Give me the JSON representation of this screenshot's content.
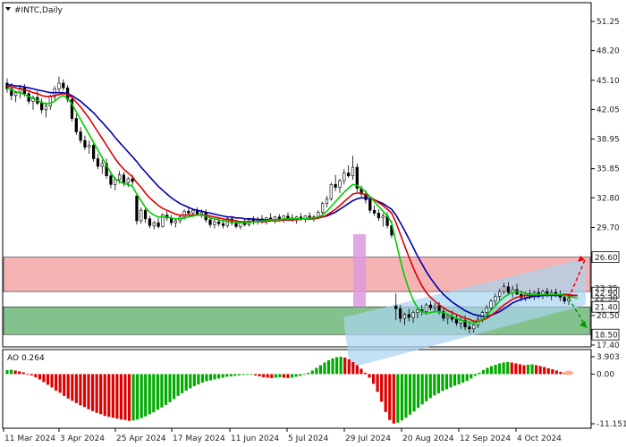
{
  "chart_data": {
    "type": "candlestick",
    "title": "#INTC,Daily",
    "ao_label": "AO 0.264",
    "price_ticks": [
      "51.25",
      "48.20",
      "45.10",
      "42.05",
      "38.95",
      "35.85",
      "32.80",
      "29.70",
      "20.50",
      "17.40"
    ],
    "level_labels": [
      "26.60",
      "22.90",
      "21.40",
      "18.50"
    ],
    "extra_labels": [
      "23.35",
      "22.30"
    ],
    "ao_ticks": [
      "3.903",
      "0.00",
      "-11.151"
    ],
    "x_labels": [
      "11 Mar 2024",
      "3 Apr 2024",
      "25 Apr 2024",
      "17 May 2024",
      "11 Jun 2024",
      "5 Jul 2024",
      "29 Jul 2024",
      "20 Aug 2024",
      "12 Sep 2024",
      "4 Oct 2024"
    ],
    "resistance_zone": [
      23.0,
      26.6
    ],
    "support_zone": [
      18.5,
      21.4
    ],
    "colors": {
      "bull": "#000000",
      "bear": "#000000",
      "ma_fast": "#00cc00",
      "ma_mid": "#dd0000",
      "ma_slow": "#0000aa",
      "resistance": "#f4a6a6",
      "support": "#6fb87a",
      "channel": "#a9d4f0",
      "ao_up": "#00aa00",
      "ao_down": "#dd0000",
      "arrow_up": "#ff0000",
      "arrow_down": "#009900"
    },
    "candles": [
      [
        44.8,
        45.3,
        43.8,
        44.2
      ],
      [
        44.2,
        44.8,
        43.0,
        43.5
      ],
      [
        43.5,
        44.0,
        42.8,
        43.8
      ],
      [
        43.8,
        44.6,
        43.2,
        44.3
      ],
      [
        44.3,
        44.7,
        43.4,
        43.7
      ],
      [
        43.7,
        44.1,
        42.6,
        42.9
      ],
      [
        42.9,
        43.5,
        42.0,
        43.3
      ],
      [
        43.3,
        44.0,
        42.5,
        42.7
      ],
      [
        42.7,
        43.2,
        41.6,
        42.0
      ],
      [
        42.0,
        42.8,
        41.2,
        42.4
      ],
      [
        42.4,
        43.6,
        42.0,
        43.4
      ],
      [
        43.4,
        44.5,
        43.0,
        44.2
      ],
      [
        44.2,
        45.5,
        43.9,
        44.8
      ],
      [
        44.8,
        45.2,
        44.0,
        44.3
      ],
      [
        44.3,
        44.6,
        42.8,
        43.1
      ],
      [
        43.1,
        43.4,
        40.8,
        41.1
      ],
      [
        41.1,
        41.6,
        39.4,
        39.7
      ],
      [
        39.7,
        40.2,
        38.5,
        38.8
      ],
      [
        38.8,
        39.3,
        37.8,
        38.1
      ],
      [
        38.1,
        38.8,
        37.4,
        38.3
      ],
      [
        38.3,
        38.6,
        36.6,
        36.9
      ],
      [
        36.9,
        37.4,
        35.8,
        36.1
      ],
      [
        36.1,
        36.8,
        35.3,
        36.4
      ],
      [
        36.4,
        36.9,
        34.8,
        35.1
      ],
      [
        35.1,
        35.6,
        33.8,
        34.2
      ],
      [
        34.2,
        35.0,
        33.6,
        34.7
      ],
      [
        34.7,
        35.6,
        34.3,
        35.2
      ],
      [
        35.2,
        35.5,
        34.0,
        34.4
      ],
      [
        34.4,
        35.0,
        33.9,
        34.8
      ],
      [
        34.8,
        35.2,
        34.1,
        34.5
      ],
      [
        33.0,
        33.3,
        30.0,
        30.4
      ],
      [
        30.4,
        31.8,
        30.1,
        31.5
      ],
      [
        31.5,
        31.8,
        30.2,
        30.6
      ],
      [
        30.6,
        30.9,
        29.6,
        29.9
      ],
      [
        29.9,
        30.4,
        29.5,
        30.2
      ],
      [
        30.2,
        30.7,
        29.6,
        29.8
      ],
      [
        29.8,
        31.2,
        29.7,
        31.0
      ],
      [
        31.0,
        31.5,
        30.4,
        30.7
      ],
      [
        30.7,
        31.0,
        29.9,
        30.2
      ],
      [
        30.2,
        30.6,
        29.7,
        30.4
      ],
      [
        30.4,
        31.0,
        30.1,
        30.8
      ],
      [
        30.8,
        31.6,
        30.5,
        31.4
      ],
      [
        31.4,
        31.9,
        30.9,
        31.2
      ],
      [
        31.2,
        31.7,
        30.8,
        31.5
      ],
      [
        31.5,
        31.8,
        30.9,
        31.1
      ],
      [
        31.1,
        31.6,
        30.7,
        31.3
      ],
      [
        31.3,
        31.6,
        30.2,
        30.5
      ],
      [
        30.5,
        30.9,
        29.7,
        30.0
      ],
      [
        30.0,
        30.6,
        29.6,
        30.3
      ],
      [
        30.3,
        30.7,
        29.8,
        30.1
      ],
      [
        30.1,
        30.5,
        29.6,
        29.9
      ],
      [
        29.9,
        30.8,
        29.7,
        30.6
      ],
      [
        30.6,
        30.9,
        29.9,
        30.2
      ],
      [
        30.2,
        30.5,
        29.6,
        29.8
      ],
      [
        29.8,
        30.4,
        29.5,
        30.2
      ],
      [
        30.2,
        30.6,
        29.8,
        30.0
      ],
      [
        30.0,
        30.7,
        29.8,
        30.5
      ],
      [
        30.5,
        30.9,
        30.0,
        30.3
      ],
      [
        30.3,
        30.8,
        30.0,
        30.6
      ],
      [
        30.6,
        31.0,
        30.1,
        30.4
      ],
      [
        30.4,
        30.8,
        30.0,
        30.7
      ],
      [
        30.7,
        31.2,
        30.3,
        30.5
      ],
      [
        30.5,
        30.9,
        30.1,
        30.8
      ],
      [
        30.8,
        31.1,
        30.3,
        30.6
      ],
      [
        30.6,
        31.0,
        30.2,
        30.9
      ],
      [
        30.9,
        31.3,
        30.4,
        30.7
      ],
      [
        30.7,
        31.1,
        30.3,
        30.5
      ],
      [
        30.5,
        30.9,
        30.1,
        30.8
      ],
      [
        30.8,
        31.2,
        30.4,
        30.6
      ],
      [
        30.6,
        31.0,
        30.2,
        30.9
      ],
      [
        30.9,
        31.3,
        30.5,
        30.7
      ],
      [
        30.7,
        31.0,
        30.3,
        30.8
      ],
      [
        30.8,
        31.5,
        30.6,
        31.3
      ],
      [
        31.3,
        32.4,
        31.1,
        32.2
      ],
      [
        32.2,
        33.0,
        31.8,
        32.7
      ],
      [
        32.7,
        34.4,
        32.5,
        34.2
      ],
      [
        34.2,
        35.2,
        33.5,
        33.9
      ],
      [
        33.9,
        34.8,
        33.3,
        34.6
      ],
      [
        34.6,
        35.8,
        34.2,
        35.4
      ],
      [
        35.4,
        36.2,
        34.9,
        35.1
      ],
      [
        35.1,
        37.2,
        34.7,
        36.0
      ],
      [
        36.0,
        36.4,
        33.4,
        33.8
      ],
      [
        33.8,
        34.1,
        32.9,
        33.2
      ],
      [
        33.2,
        33.6,
        32.2,
        32.6
      ],
      [
        32.6,
        33.0,
        31.2,
        31.5
      ],
      [
        31.5,
        32.0,
        30.9,
        31.2
      ],
      [
        31.2,
        31.6,
        30.4,
        30.7
      ],
      [
        30.7,
        31.2,
        29.8,
        30.9
      ],
      [
        30.9,
        31.3,
        29.6,
        29.9
      ],
      [
        29.9,
        30.4,
        28.6,
        28.9
      ],
      [
        21.5,
        22.8,
        20.0,
        21.2
      ],
      [
        21.2,
        21.6,
        19.8,
        20.2
      ],
      [
        20.2,
        20.8,
        19.5,
        20.6
      ],
      [
        20.6,
        21.2,
        19.9,
        20.3
      ],
      [
        20.3,
        21.0,
        19.7,
        20.8
      ],
      [
        20.8,
        21.4,
        20.2,
        21.1
      ],
      [
        21.1,
        21.6,
        20.5,
        20.9
      ],
      [
        20.9,
        21.8,
        20.6,
        21.6
      ],
      [
        21.6,
        22.0,
        21.0,
        21.3
      ],
      [
        21.3,
        21.8,
        20.8,
        21.5
      ],
      [
        21.5,
        21.9,
        20.6,
        20.9
      ],
      [
        20.9,
        21.3,
        19.9,
        20.2
      ],
      [
        20.2,
        20.7,
        19.6,
        20.4
      ],
      [
        20.4,
        21.0,
        19.8,
        20.1
      ],
      [
        20.1,
        20.6,
        19.4,
        19.7
      ],
      [
        19.7,
        20.3,
        19.1,
        20.0
      ],
      [
        20.0,
        20.5,
        19.0,
        19.3
      ],
      [
        19.3,
        19.8,
        18.6,
        19.1
      ],
      [
        19.1,
        19.7,
        18.7,
        19.5
      ],
      [
        19.5,
        20.4,
        19.2,
        20.1
      ],
      [
        20.1,
        21.0,
        19.8,
        20.8
      ],
      [
        20.8,
        21.6,
        20.4,
        21.3
      ],
      [
        21.3,
        22.2,
        21.0,
        22.0
      ],
      [
        22.0,
        22.8,
        21.5,
        22.5
      ],
      [
        22.5,
        23.3,
        22.1,
        23.0
      ],
      [
        23.0,
        23.9,
        22.7,
        23.5
      ],
      [
        23.5,
        24.0,
        22.6,
        22.9
      ],
      [
        22.9,
        23.6,
        22.4,
        23.2
      ],
      [
        23.2,
        23.8,
        22.8,
        22.7
      ],
      [
        22.7,
        23.1,
        22.0,
        22.4
      ],
      [
        22.4,
        23.0,
        22.0,
        22.8
      ],
      [
        22.8,
        23.2,
        22.2,
        22.5
      ],
      [
        22.5,
        23.1,
        22.1,
        22.9
      ],
      [
        22.9,
        23.4,
        22.3,
        22.6
      ],
      [
        22.6,
        23.2,
        22.2,
        23.0
      ],
      [
        23.0,
        23.4,
        22.4,
        22.7
      ],
      [
        22.7,
        23.2,
        22.1,
        22.9
      ],
      [
        22.9,
        23.3,
        22.4,
        22.6
      ],
      [
        22.6,
        23.1,
        22.0,
        22.4
      ],
      [
        22.4,
        22.8,
        21.7,
        22.0
      ],
      [
        22.0,
        22.6,
        21.6,
        22.3
      ]
    ],
    "ao": [
      0.9,
      1.0,
      0.8,
      0.6,
      0.4,
      0.1,
      -0.3,
      -0.7,
      -1.2,
      -1.8,
      -2.4,
      -3.0,
      -3.7,
      -4.2,
      -4.9,
      -5.5,
      -6.0,
      -6.5,
      -7.0,
      -7.4,
      -7.9,
      -8.3,
      -8.7,
      -9.0,
      -9.4,
      -9.6,
      -9.8,
      -10.0,
      -10.2,
      -10.3,
      -10.5,
      -10.4,
      -10.2,
      -9.9,
      -9.5,
      -9.0,
      -8.6,
      -8.0,
      -7.5,
      -6.9,
      -6.3,
      -5.6,
      -4.9,
      -4.3,
      -3.7,
      -3.2,
      -2.7,
      -2.3,
      -1.9,
      -1.6,
      -1.4,
      -1.2,
      -1.0,
      -0.8,
      -0.6,
      -0.5,
      -0.4,
      -0.3,
      -0.2,
      -0.1,
      -0.1,
      -0.3,
      -0.5,
      -0.7,
      -0.8,
      -0.9,
      -0.8,
      -0.7,
      -0.8,
      -0.9,
      -0.8,
      -0.6,
      -0.4,
      -0.1,
      0.3,
      0.8,
      1.4,
      2.0,
      2.6,
      3.1,
      3.5,
      3.8,
      3.9,
      3.7,
      3.3,
      2.7,
      2.0,
      1.2,
      0.3,
      -0.8,
      -2.2,
      -4.0,
      -6.2,
      -8.5,
      -10.3,
      -11.1,
      -10.9,
      -10.4,
      -9.8,
      -9.1,
      -8.4,
      -7.6,
      -6.8,
      -6.1,
      -5.4,
      -4.8,
      -4.3,
      -3.8,
      -3.4,
      -3.0,
      -2.6,
      -2.3,
      -1.9,
      -1.5,
      -1.0,
      -0.4,
      0.3,
      0.9,
      1.4,
      1.8,
      2.1,
      2.4,
      2.6,
      2.7,
      2.6,
      2.4,
      2.2,
      2.0,
      2.1,
      2.2,
      2.0,
      1.8,
      1.6,
      1.3,
      1.1,
      0.8,
      0.5,
      0.3,
      0.26
    ],
    "ma_fast": [
      44.3,
      44.1,
      43.9,
      43.8,
      43.6,
      43.4,
      43.2,
      43.0,
      42.8,
      42.6,
      42.7,
      42.9,
      43.3,
      43.5,
      43.2,
      42.6,
      41.8,
      41.0,
      40.2,
      39.4,
      38.6,
      37.8,
      37.0,
      36.2,
      35.4,
      34.8,
      34.5,
      34.3,
      34.2,
      34.0,
      33.2,
      32.5,
      31.8,
      31.3,
      31.0,
      30.8,
      30.8,
      30.8,
      30.7,
      30.6,
      30.6,
      30.7,
      30.8,
      30.9,
      31.0,
      31.0,
      30.9,
      30.7,
      30.6,
      30.5,
      30.4,
      30.3,
      30.3,
      30.2,
      30.2,
      30.2,
      30.2,
      30.3,
      30.3,
      30.4,
      30.4,
      30.5,
      30.5,
      30.5,
      30.6,
      30.6,
      30.6,
      30.6,
      30.6,
      30.6,
      30.7,
      30.7,
      30.8,
      31.0,
      31.4,
      31.9,
      32.4,
      32.9,
      33.4,
      33.8,
      34.2,
      34.1,
      33.8,
      33.4,
      32.9,
      32.4,
      31.9,
      31.4,
      30.9,
      30.2,
      28.2,
      26.3,
      24.6,
      23.2,
      22.1,
      21.3,
      20.9,
      20.7,
      20.8,
      20.9,
      20.9,
      20.8,
      20.6,
      20.4,
      20.2,
      20.0,
      19.9,
      19.8,
      19.7,
      19.8,
      20.1,
      20.5,
      21.0,
      21.5,
      22.0,
      22.4,
      22.7,
      22.9,
      23.0,
      22.9,
      22.8,
      22.7,
      22.7,
      22.7,
      22.7,
      22.7,
      22.7,
      22.7,
      22.7,
      22.6,
      22.5,
      22.4,
      22.3
    ],
    "ma_mid": [
      44.5,
      44.4,
      44.3,
      44.2,
      44.1,
      44.0,
      43.8,
      43.7,
      43.5,
      43.4,
      43.4,
      43.5,
      43.6,
      43.7,
      43.6,
      43.3,
      42.8,
      42.3,
      41.7,
      41.1,
      40.4,
      39.7,
      39.0,
      38.3,
      37.6,
      36.9,
      36.3,
      35.8,
      35.4,
      35.0,
      34.4,
      33.9,
      33.3,
      32.8,
      32.4,
      32.0,
      31.7,
      31.5,
      31.3,
      31.1,
      31.0,
      31.0,
      31.0,
      31.0,
      31.0,
      31.0,
      31.0,
      30.9,
      30.8,
      30.7,
      30.6,
      30.5,
      30.5,
      30.4,
      30.3,
      30.3,
      30.3,
      30.3,
      30.3,
      30.3,
      30.3,
      30.4,
      30.4,
      30.4,
      30.5,
      30.5,
      30.5,
      30.5,
      30.6,
      30.6,
      30.6,
      30.6,
      30.7,
      30.8,
      31.0,
      31.3,
      31.6,
      32.0,
      32.4,
      32.8,
      33.2,
      33.3,
      33.3,
      33.1,
      32.9,
      32.6,
      32.3,
      32.0,
      31.6,
      31.2,
      30.2,
      29.0,
      27.8,
      26.6,
      25.5,
      24.5,
      23.6,
      22.9,
      22.4,
      22.0,
      21.6,
      21.3,
      21.0,
      20.8,
      20.6,
      20.4,
      20.2,
      20.1,
      19.9,
      19.9,
      20.0,
      20.2,
      20.5,
      20.8,
      21.2,
      21.6,
      21.9,
      22.2,
      22.4,
      22.5,
      22.6,
      22.6,
      22.6,
      22.7,
      22.7,
      22.7,
      22.7,
      22.7,
      22.7,
      22.7,
      22.7,
      22.6,
      22.6
    ],
    "ma_slow": [
      44.6,
      44.6,
      44.5,
      44.5,
      44.4,
      44.3,
      44.2,
      44.1,
      44.0,
      43.9,
      43.8,
      43.8,
      43.8,
      43.8,
      43.7,
      43.5,
      43.2,
      42.9,
      42.5,
      42.1,
      41.7,
      41.2,
      40.7,
      40.2,
      39.7,
      39.1,
      38.6,
      38.1,
      37.6,
      37.1,
      36.6,
      36.0,
      35.5,
      35.0,
      34.5,
      34.0,
      33.6,
      33.2,
      32.8,
      32.5,
      32.2,
      32.0,
      31.8,
      31.6,
      31.5,
      31.4,
      31.3,
      31.2,
      31.1,
      31.0,
      30.9,
      30.8,
      30.8,
      30.7,
      30.7,
      30.6,
      30.6,
      30.6,
      30.5,
      30.5,
      30.5,
      30.5,
      30.5,
      30.5,
      30.5,
      30.5,
      30.5,
      30.6,
      30.6,
      30.6,
      30.6,
      30.6,
      30.7,
      30.8,
      30.9,
      31.1,
      31.3,
      31.6,
      31.9,
      32.2,
      32.5,
      32.7,
      32.8,
      32.8,
      32.7,
      32.6,
      32.4,
      32.2,
      31.9,
      31.6,
      31.0,
      30.2,
      29.4,
      28.5,
      27.6,
      26.7,
      25.9,
      25.1,
      24.4,
      23.8,
      23.2,
      22.7,
      22.3,
      21.9,
      21.6,
      21.3,
      21.0,
      20.8,
      20.6,
      20.5,
      20.4,
      20.4,
      20.5,
      20.7,
      20.9,
      21.2,
      21.5,
      21.8,
      22.0,
      22.2,
      22.3,
      22.4,
      22.5,
      22.5,
      22.6,
      22.6,
      22.6,
      22.6,
      22.6,
      22.6,
      22.6,
      22.6,
      22.6
    ]
  }
}
